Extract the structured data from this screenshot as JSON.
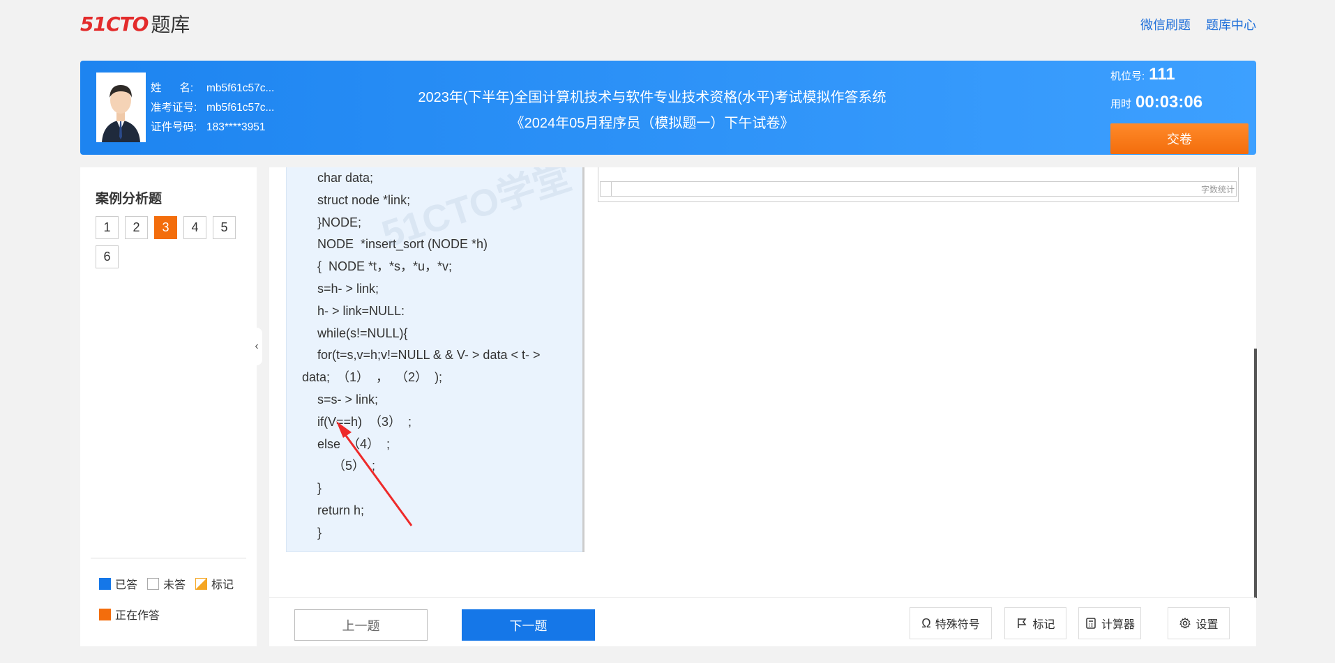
{
  "topbar": {
    "logo_mark": "51CTO",
    "logo_text": "题库",
    "links": [
      "微信刷题",
      "题库中心"
    ]
  },
  "header": {
    "name_label": "姓      名:",
    "name_value": "mb5f61c57c...",
    "ticket_label": "准考证号:",
    "ticket_value": "mb5f61c57c...",
    "id_label": "证件号码:",
    "id_value": "183****3951",
    "title_line1": "2023年(下半年)全国计算机技术与软件专业技术资格(水平)考试模拟作答系统",
    "title_line2": "《2024年05月程序员（模拟题一）下午试卷》",
    "seat_label": "机位号:",
    "seat_value": "111",
    "time_label": "用时",
    "time_value": "00:03:06",
    "submit_label": "交卷"
  },
  "sidebar": {
    "section_title": "案例分析题",
    "questions": [
      "1",
      "2",
      "3",
      "4",
      "5",
      "6"
    ],
    "current_index": 2,
    "legend": {
      "answered": "已答",
      "unanswered": "未答",
      "marked": "标记",
      "current": "正在作答"
    }
  },
  "code": {
    "watermark": "51CTO学堂",
    "lines": [
      "char data;",
      "struct node *link;",
      "}NODE;",
      "NODE  *insert_sort (NODE *h)",
      "{  NODE *t，*s，*u，*v;",
      "s=h- > link;",
      "h- > link=NULL:",
      "while(s!=NULL){",
      "for(t=s,v=h;v!=NULL & & V- > data < t- >",
      "data;  （1）  ，  （2）  );",
      "s=s- > link;",
      "if(V==h)  （3）  ;",
      "else  （4）  ;",
      "（5）  ;",
      "}",
      "return h;",
      "}"
    ]
  },
  "answer": {
    "word_count_label": "字数统计"
  },
  "toolbar": {
    "prev": "上一题",
    "next": "下一题",
    "special_chars": "特殊符号",
    "mark": "标记",
    "calculator": "计算器",
    "settings": "设置"
  },
  "colors": {
    "brand_blue": "#1577e8",
    "accent_orange": "#f36d0c",
    "logo_red": "#e32b2b"
  }
}
